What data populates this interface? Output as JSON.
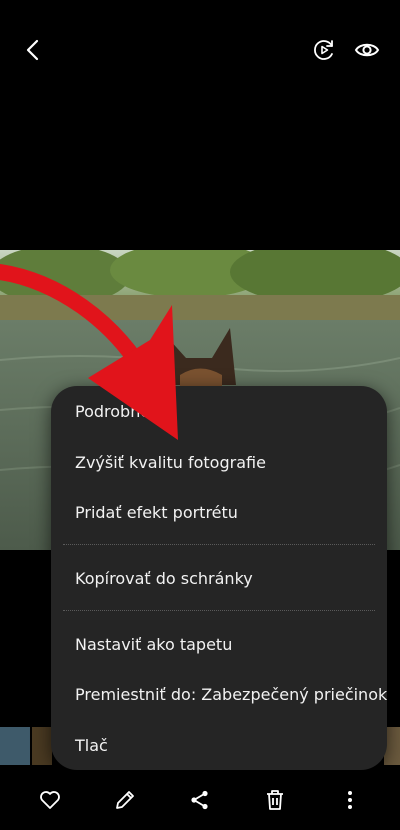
{
  "top_bar": {
    "icons": [
      "back-icon",
      "play-motion-icon",
      "eye-icon"
    ]
  },
  "photo": {
    "subject": "dog-by-river-photo"
  },
  "context_menu": {
    "items": [
      "Podrobnosti",
      "Zvýšiť kvalitu fotografie",
      "Pridať efekt portrétu",
      "Kopírovať do schránky",
      "Nastaviť ako tapetu",
      "Premiestniť do: Zabezpečený priečinok",
      "Tlač"
    ]
  },
  "bottom_bar": {
    "icons": [
      "heart-icon",
      "edit-pencil-icon",
      "share-icon",
      "delete-icon",
      "more-icon"
    ]
  },
  "colors": {
    "menu_bg": "#252525",
    "arrow": "#e1141b",
    "background": "#000000"
  }
}
